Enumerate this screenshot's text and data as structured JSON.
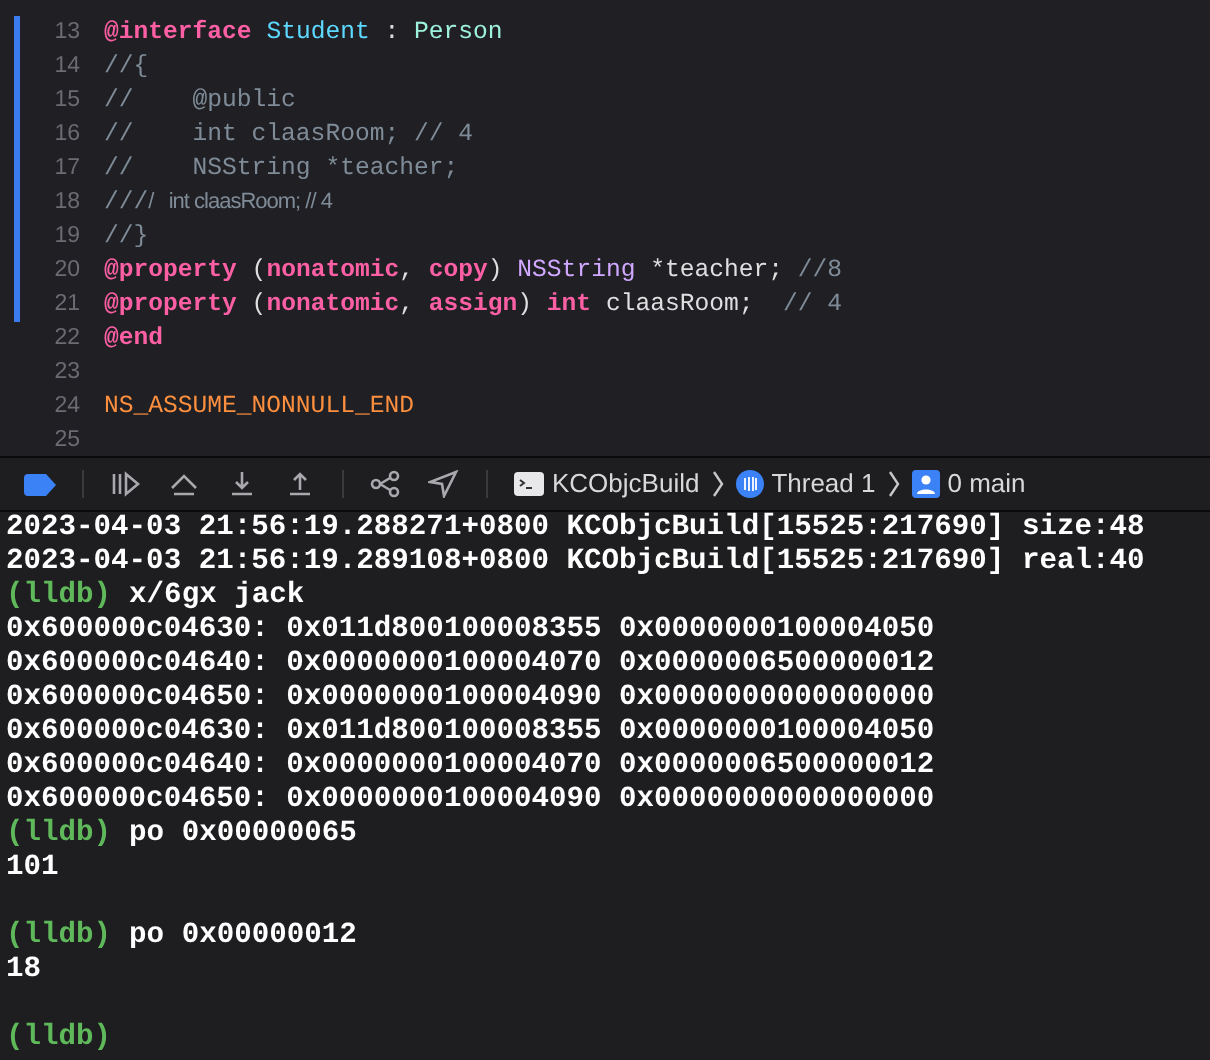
{
  "editor": {
    "lines": [
      {
        "number": "13",
        "changed": true,
        "tokens": [
          {
            "kind": "keyword",
            "text": "@interface "
          },
          {
            "kind": "class",
            "text": "Student"
          },
          {
            "kind": "plain",
            "text": " : "
          },
          {
            "kind": "superclass",
            "text": "Person"
          }
        ]
      },
      {
        "number": "14",
        "changed": true,
        "tokens": [
          {
            "kind": "comment",
            "text": "//{"
          }
        ]
      },
      {
        "number": "15",
        "changed": true,
        "tokens": [
          {
            "kind": "comment",
            "text": "//    @public"
          }
        ]
      },
      {
        "number": "16",
        "changed": true,
        "tokens": [
          {
            "kind": "comment",
            "text": "//    int claasRoom; // 4"
          }
        ]
      },
      {
        "number": "17",
        "changed": true,
        "tokens": [
          {
            "kind": "comment",
            "text": "//    NSString *teacher;"
          }
        ]
      },
      {
        "number": "18",
        "changed": true,
        "tokens": [
          {
            "kind": "comment",
            "text": "///"
          },
          {
            "kind": "doc",
            "text": "/   int claasRoom; // 4"
          }
        ]
      },
      {
        "number": "19",
        "changed": true,
        "tokens": [
          {
            "kind": "comment",
            "text": "//}"
          }
        ]
      },
      {
        "number": "20",
        "changed": true,
        "tokens": [
          {
            "kind": "keyword",
            "text": "@property"
          },
          {
            "kind": "plain",
            "text": " ("
          },
          {
            "kind": "keyword",
            "text": "nonatomic"
          },
          {
            "kind": "plain",
            "text": ", "
          },
          {
            "kind": "keyword",
            "text": "copy"
          },
          {
            "kind": "plain",
            "text": ") "
          },
          {
            "kind": "type",
            "text": "NSString"
          },
          {
            "kind": "plain",
            "text": " *teacher; "
          },
          {
            "kind": "comment",
            "text": "//8"
          }
        ]
      },
      {
        "number": "21",
        "changed": true,
        "tokens": [
          {
            "kind": "keyword",
            "text": "@property"
          },
          {
            "kind": "plain",
            "text": " ("
          },
          {
            "kind": "keyword",
            "text": "nonatomic"
          },
          {
            "kind": "plain",
            "text": ", "
          },
          {
            "kind": "keyword",
            "text": "assign"
          },
          {
            "kind": "plain",
            "text": ") "
          },
          {
            "kind": "keyword",
            "text": "int"
          },
          {
            "kind": "plain",
            "text": " claasRoom;  "
          },
          {
            "kind": "comment",
            "text": "// 4"
          }
        ]
      },
      {
        "number": "22",
        "changed": false,
        "tokens": [
          {
            "kind": "keyword",
            "text": "@end"
          }
        ]
      },
      {
        "number": "23",
        "changed": false
      },
      {
        "number": "24",
        "changed": false,
        "tokens": [
          {
            "kind": "macro",
            "text": "NS_ASSUME_NONNULL_END"
          }
        ]
      },
      {
        "number": "25",
        "changed": false
      }
    ]
  },
  "debug_bar": {
    "breadcrumbs": [
      {
        "kind": "target",
        "label": "KCObjcBuild"
      },
      {
        "kind": "thread",
        "label": "Thread 1"
      },
      {
        "kind": "frame",
        "label": "0 main"
      }
    ]
  },
  "console": {
    "lines": [
      {
        "kind": "output",
        "text": "2023-04-03 21:56:19.288271+0800 KCObjcBuild[15525:217690] size:48"
      },
      {
        "kind": "output",
        "text": "2023-04-03 21:56:19.289108+0800 KCObjcBuild[15525:217690] real:40"
      },
      {
        "kind": "prompt",
        "prompt": "(lldb)",
        "command": "x/6gx jack"
      },
      {
        "kind": "output",
        "text": "0x600000c04630: 0x011d800100008355 0x0000000100004050"
      },
      {
        "kind": "output",
        "text": "0x600000c04640: 0x0000000100004070 0x0000006500000012"
      },
      {
        "kind": "output",
        "text": "0x600000c04650: 0x0000000100004090 0x0000000000000000"
      },
      {
        "kind": "output",
        "text": "0x600000c04630: 0x011d800100008355 0x0000000100004050"
      },
      {
        "kind": "output",
        "text": "0x600000c04640: 0x0000000100004070 0x0000006500000012"
      },
      {
        "kind": "output",
        "text": "0x600000c04650: 0x0000000100004090 0x0000000000000000"
      },
      {
        "kind": "prompt",
        "prompt": "(lldb)",
        "command": "po 0x00000065"
      },
      {
        "kind": "output",
        "text": "101"
      },
      {
        "kind": "blank"
      },
      {
        "kind": "prompt",
        "prompt": "(lldb)",
        "command": "po 0x00000012"
      },
      {
        "kind": "output",
        "text": "18"
      },
      {
        "kind": "blank"
      },
      {
        "kind": "prompt",
        "prompt": "(lldb)"
      }
    ]
  }
}
